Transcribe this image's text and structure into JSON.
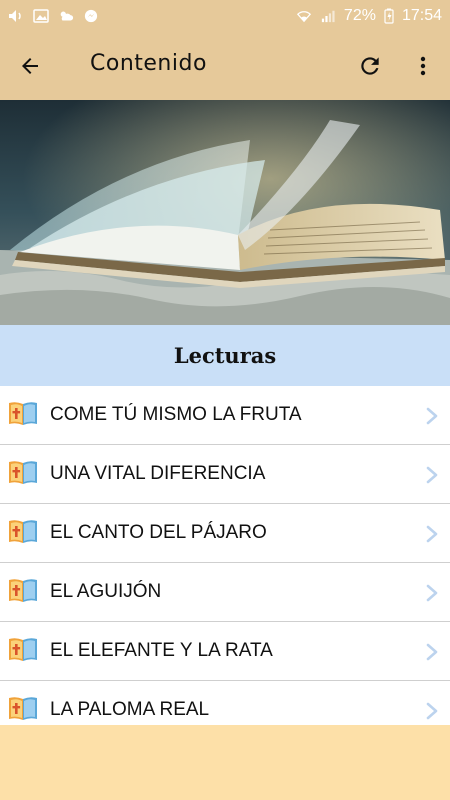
{
  "status_bar": {
    "battery": "72%",
    "time": "17:54"
  },
  "app_bar": {
    "title": "Contenido",
    "back_icon": "arrow-left-icon",
    "refresh_icon": "refresh-icon",
    "more_icon": "more-vertical-icon"
  },
  "section": {
    "title": "Lecturas"
  },
  "list": {
    "items": [
      {
        "label": "COME TÚ MISMO LA FRUTA"
      },
      {
        "label": "UNA VITAL DIFERENCIA"
      },
      {
        "label": "EL CANTO DEL PÁJARO"
      },
      {
        "label": "EL AGUIJÓN"
      },
      {
        "label": "EL ELEFANTE Y LA RATA"
      },
      {
        "label": "LA PALOMA REAL"
      }
    ],
    "item_icon": "book-cross-icon",
    "chevron_icon": "chevron-right-icon"
  },
  "colors": {
    "app_bar": "#e6c99a",
    "section_header": "#c9dff7",
    "footer": "#fde0a8",
    "chevron": "#bcd3ee"
  }
}
